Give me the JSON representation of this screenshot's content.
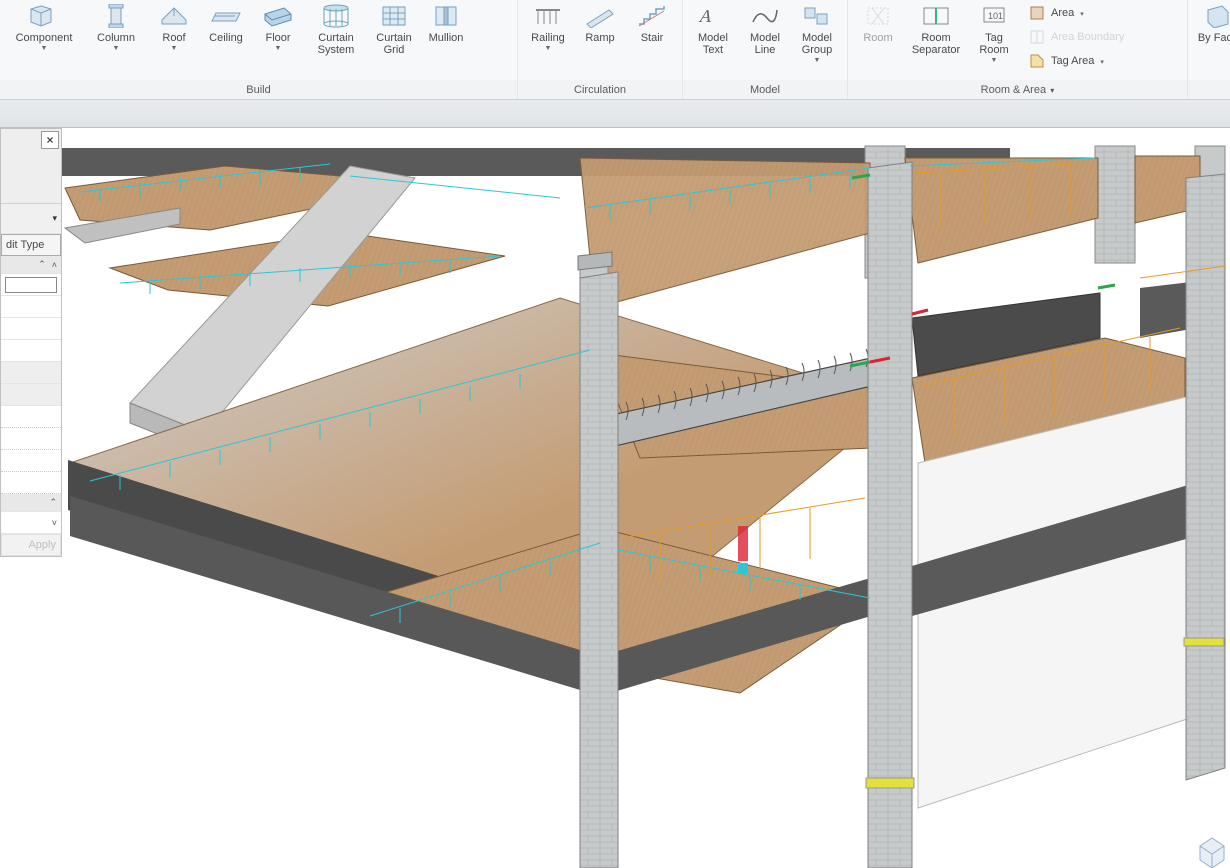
{
  "ribbon": {
    "build": {
      "label": "Build",
      "buttons": [
        {
          "id": "component",
          "label": "Component",
          "dropdown": true
        },
        {
          "id": "column",
          "label": "Column",
          "dropdown": true
        },
        {
          "id": "roof",
          "label": "Roof",
          "dropdown": true
        },
        {
          "id": "ceiling",
          "label": "Ceiling"
        },
        {
          "id": "floor",
          "label": "Floor",
          "dropdown": true
        },
        {
          "id": "curtain-system",
          "label": "Curtain System"
        },
        {
          "id": "curtain-grid",
          "label": "Curtain Grid"
        },
        {
          "id": "mullion",
          "label": "Mullion"
        }
      ]
    },
    "circulation": {
      "label": "Circulation",
      "buttons": [
        {
          "id": "railing",
          "label": "Railing",
          "dropdown": true
        },
        {
          "id": "ramp",
          "label": "Ramp"
        },
        {
          "id": "stair",
          "label": "Stair"
        }
      ]
    },
    "model": {
      "label": "Model",
      "buttons": [
        {
          "id": "model-text",
          "label": "Model Text"
        },
        {
          "id": "model-line",
          "label": "Model Line"
        },
        {
          "id": "model-group",
          "label": "Model Group",
          "dropdown": true
        }
      ]
    },
    "room_area": {
      "label": "Room & Area",
      "dropdown": true,
      "room": "Room",
      "room_separator": "Room Separator",
      "tag_room": "Tag Room",
      "area": "Area",
      "area_boundary": "Area  Boundary",
      "tag_area": "Tag  Area"
    },
    "by_face": {
      "label": "By Face"
    }
  },
  "properties": {
    "close": "×",
    "edit_type": "dit Type",
    "apply": "Apply"
  }
}
